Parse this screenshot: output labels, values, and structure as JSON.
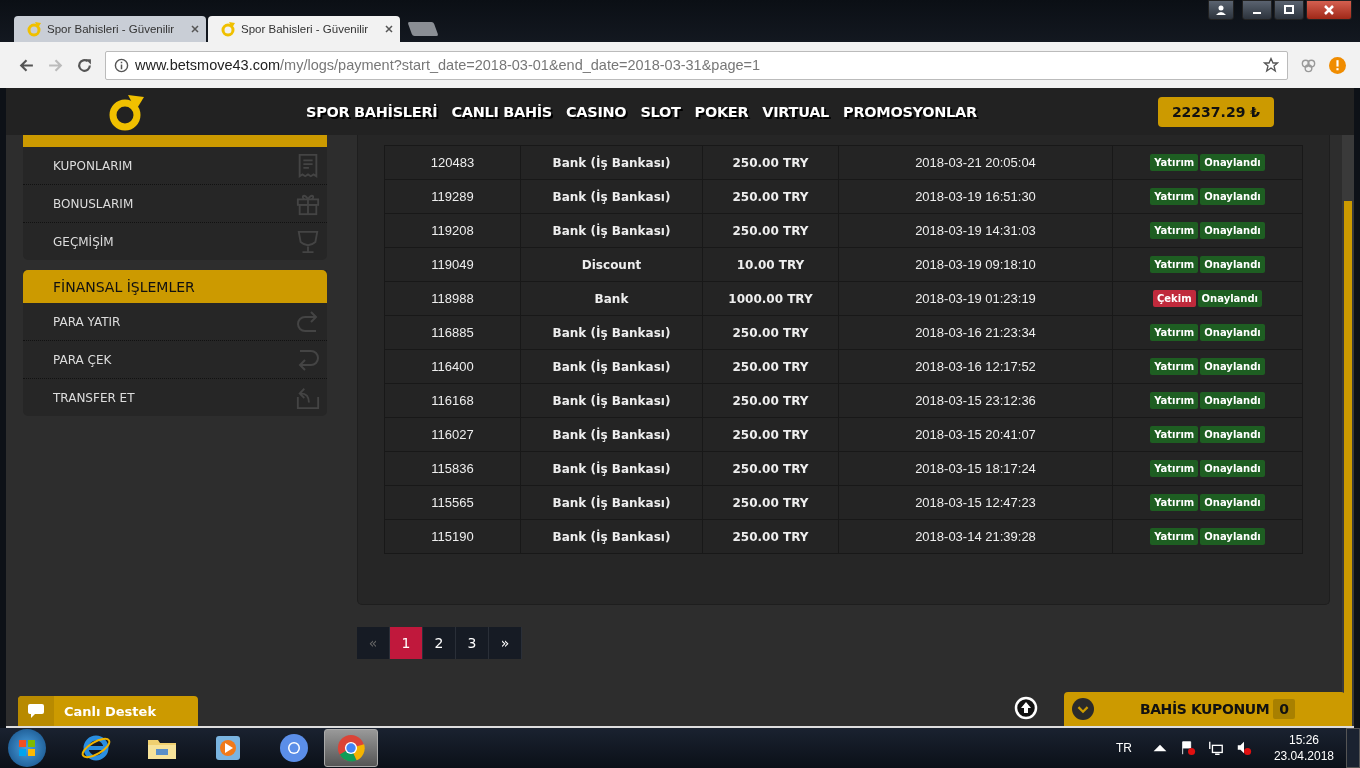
{
  "browser": {
    "tabs": [
      {
        "title": "Spor Bahisleri - Güvenilir",
        "selected": false
      },
      {
        "title": "Spor Bahisleri - Güvenilir",
        "selected": true
      }
    ],
    "url": {
      "host": "www.betsmove43.com",
      "path": "/my/logs/payment?start_date=2018-03-01&end_date=2018-03-31&page=1"
    }
  },
  "header": {
    "nav": [
      "SPOR BAHİSLERİ",
      "CANLI BAHİS",
      "CASINO",
      "SLOT",
      "POKER",
      "VIRTUAL",
      "PROMOSYONLAR"
    ],
    "balance": "22237.29 ₺"
  },
  "sidebar": {
    "groups": [
      {
        "items": [
          {
            "label": "KUPONLARIM"
          },
          {
            "label": "BONUSLARIM"
          },
          {
            "label": "GEÇMİŞİM"
          }
        ]
      },
      {
        "title": "FİNANSAL İŞLEMLER",
        "items": [
          {
            "label": "PARA YATIR"
          },
          {
            "label": "PARA ÇEK"
          },
          {
            "label": "TRANSFER ET"
          }
        ]
      }
    ]
  },
  "table": {
    "rows": [
      {
        "id": "120483",
        "method": "Bank (İş Bankası)",
        "amount": "250.00 TRY",
        "date": "2018-03-21 20:05:04",
        "type": {
          "label": "Yatırım",
          "kind": "deposit"
        },
        "status": "Onaylandı"
      },
      {
        "id": "119289",
        "method": "Bank (İş Bankası)",
        "amount": "250.00 TRY",
        "date": "2018-03-19 16:51:30",
        "type": {
          "label": "Yatırım",
          "kind": "deposit"
        },
        "status": "Onaylandı"
      },
      {
        "id": "119208",
        "method": "Bank (İş Bankası)",
        "amount": "250.00 TRY",
        "date": "2018-03-19 14:31:03",
        "type": {
          "label": "Yatırım",
          "kind": "deposit"
        },
        "status": "Onaylandı"
      },
      {
        "id": "119049",
        "method": "Discount",
        "amount": "10.00 TRY",
        "date": "2018-03-19 09:18:10",
        "type": {
          "label": "Yatırım",
          "kind": "deposit"
        },
        "status": "Onaylandı"
      },
      {
        "id": "118988",
        "method": "Bank",
        "amount": "1000.00 TRY",
        "date": "2018-03-19 01:23:19",
        "type": {
          "label": "Çekim",
          "kind": "withdrawal"
        },
        "status": "Onaylandı"
      },
      {
        "id": "116885",
        "method": "Bank (İş Bankası)",
        "amount": "250.00 TRY",
        "date": "2018-03-16 21:23:34",
        "type": {
          "label": "Yatırım",
          "kind": "deposit"
        },
        "status": "Onaylandı"
      },
      {
        "id": "116400",
        "method": "Bank (İş Bankası)",
        "amount": "250.00 TRY",
        "date": "2018-03-16 12:17:52",
        "type": {
          "label": "Yatırım",
          "kind": "deposit"
        },
        "status": "Onaylandı"
      },
      {
        "id": "116168",
        "method": "Bank (İş Bankası)",
        "amount": "250.00 TRY",
        "date": "2018-03-15 23:12:36",
        "type": {
          "label": "Yatırım",
          "kind": "deposit"
        },
        "status": "Onaylandı"
      },
      {
        "id": "116027",
        "method": "Bank (İş Bankası)",
        "amount": "250.00 TRY",
        "date": "2018-03-15 20:41:07",
        "type": {
          "label": "Yatırım",
          "kind": "deposit"
        },
        "status": "Onaylandı"
      },
      {
        "id": "115836",
        "method": "Bank (İş Bankası)",
        "amount": "250.00 TRY",
        "date": "2018-03-15 18:17:24",
        "type": {
          "label": "Yatırım",
          "kind": "deposit"
        },
        "status": "Onaylandı"
      },
      {
        "id": "115565",
        "method": "Bank (İş Bankası)",
        "amount": "250.00 TRY",
        "date": "2018-03-15 12:47:23",
        "type": {
          "label": "Yatırım",
          "kind": "deposit"
        },
        "status": "Onaylandı"
      },
      {
        "id": "115190",
        "method": "Bank (İş Bankası)",
        "amount": "250.00 TRY",
        "date": "2018-03-14 21:39:28",
        "type": {
          "label": "Yatırım",
          "kind": "deposit"
        },
        "status": "Onaylandı"
      }
    ]
  },
  "pagination": [
    {
      "label": "«",
      "selected": false,
      "disabled": true
    },
    {
      "label": "1",
      "selected": true,
      "disabled": false
    },
    {
      "label": "2",
      "selected": false,
      "disabled": false
    },
    {
      "label": "3",
      "selected": false,
      "disabled": false
    },
    {
      "label": "»",
      "selected": false,
      "disabled": false
    }
  ],
  "live_support": "Canlı Destek",
  "bet_slip": {
    "title": "BAHİS KUPONUM",
    "count": "0"
  },
  "taskbar": {
    "language": "TR",
    "time": "15:26",
    "date": "23.04.2018"
  }
}
